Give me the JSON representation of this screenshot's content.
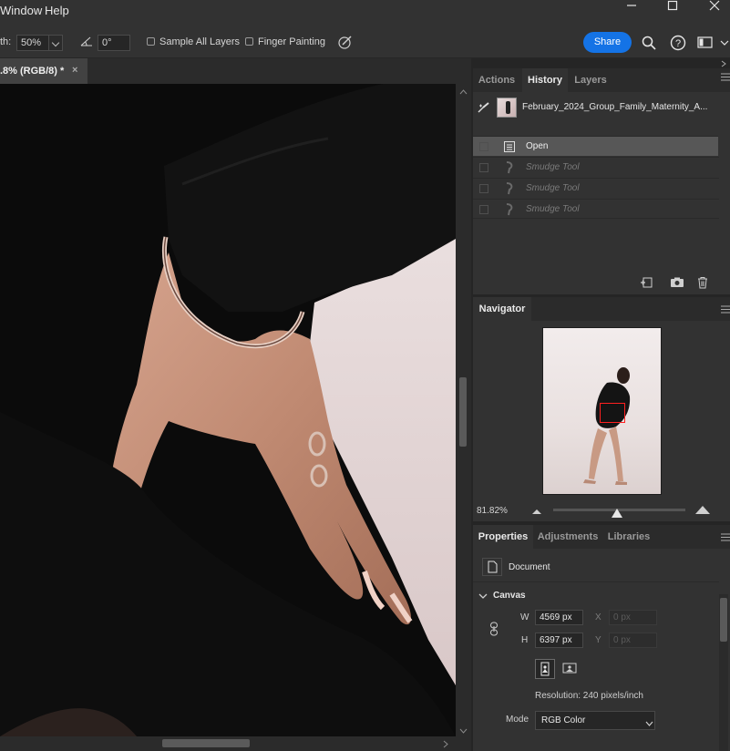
{
  "menu": {
    "items": [
      "Window",
      "Help"
    ]
  },
  "options_bar": {
    "strength_label": "th:",
    "strength_value": "50%",
    "angle_value": "0°",
    "sample_all_layers": "Sample All Layers",
    "finger_painting": "Finger Painting",
    "share": "Share"
  },
  "document": {
    "tab_title": ".8% (RGB/8) *",
    "close": "×"
  },
  "history_panel": {
    "tabs": [
      "Actions",
      "History",
      "Layers"
    ],
    "active_tab": "History",
    "source_name": "February_2024_Group_Family_Maternity_A...",
    "states": [
      {
        "label": "Open",
        "selected": true
      },
      {
        "label": "Smudge Tool",
        "selected": false
      },
      {
        "label": "Smudge Tool",
        "selected": false
      },
      {
        "label": "Smudge Tool",
        "selected": false
      }
    ]
  },
  "navigator": {
    "title": "Navigator",
    "zoom": "81.82%",
    "slider_level": 0.48
  },
  "properties_panel": {
    "tabs": [
      "Properties",
      "Adjustments",
      "Libraries"
    ],
    "active_tab": "Properties",
    "doc_label": "Document",
    "canvas_header": "Canvas",
    "w_label": "W",
    "w_value": "4569 px",
    "h_label": "H",
    "h_value": "6397 px",
    "x_label": "X",
    "x_value": "0 px",
    "y_label": "Y",
    "y_value": "0 px",
    "resolution": "Resolution: 240 pixels/inch",
    "mode_label": "Mode",
    "mode_value": "RGB Color"
  },
  "colors": {
    "accent": "#1473e6",
    "nav_frame": "#ff2020"
  }
}
